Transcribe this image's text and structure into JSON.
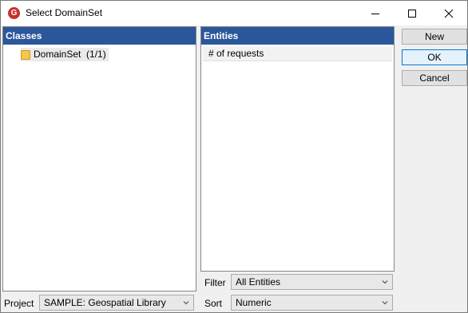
{
  "window": {
    "title": "Select DomainSet",
    "app_icon_letter": "G"
  },
  "classes": {
    "header": "Classes",
    "items": [
      {
        "label": "DomainSet  (1/1)"
      }
    ]
  },
  "entities": {
    "header": "Entities",
    "items": [
      {
        "label": "# of requests"
      }
    ]
  },
  "buttons": {
    "new": "New",
    "ok": "OK",
    "cancel": "Cancel"
  },
  "project": {
    "label": "Project",
    "value": "SAMPLE: Geospatial Library"
  },
  "filter": {
    "label": "Filter",
    "value": "All Entities"
  },
  "sort": {
    "label": "Sort",
    "value": "Numeric"
  },
  "colors": {
    "panel_header": "#2b579a",
    "app_icon": "#c8302a",
    "folder": "#f6c64e"
  }
}
